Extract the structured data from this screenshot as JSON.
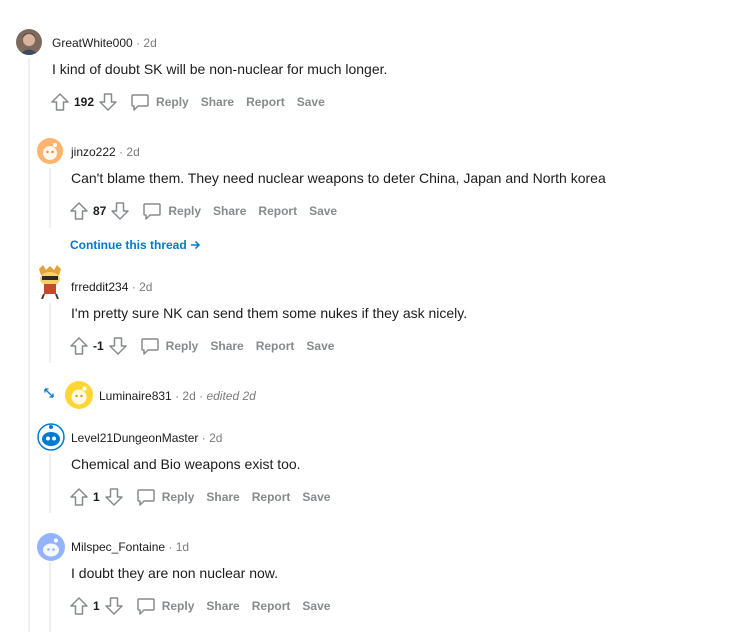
{
  "comments": [
    {
      "author": "GreatWhite000",
      "time": "2d",
      "body": "I kind of doubt SK will be non-nuclear for much longer.",
      "score": "192"
    },
    {
      "author": "jinzo222",
      "time": "2d",
      "body": "Can't blame them. They need nuclear weapons to deter China, Japan and North korea",
      "score": "87"
    },
    {
      "author": "frreddit234",
      "time": "2d",
      "body": "I'm pretty sure NK can send them some nukes if they ask nicely.",
      "score": "-1"
    },
    {
      "author": "Luminaire831",
      "time": "2d",
      "edited": "edited 2d"
    },
    {
      "author": "Level21DungeonMaster",
      "time": "2d",
      "body": "Chemical and Bio weapons exist too.",
      "score": "1"
    },
    {
      "author": "Milspec_Fontaine",
      "time": "1d",
      "body": "I doubt they are non nuclear now.",
      "score": "1"
    }
  ],
  "actions": {
    "reply": "Reply",
    "share": "Share",
    "report": "Report",
    "save": "Save"
  },
  "continue_thread": "Continue this thread",
  "separator": "·",
  "icons": {
    "upvote": "upvote-icon",
    "downvote": "downvote-icon",
    "reply": "comment-bubble-icon",
    "expand": "expand-arrows-icon",
    "arrow": "arrow-right-icon"
  },
  "colors": {
    "link": "#0079d3",
    "muted": "#878a8c",
    "line": "#edeff1"
  }
}
